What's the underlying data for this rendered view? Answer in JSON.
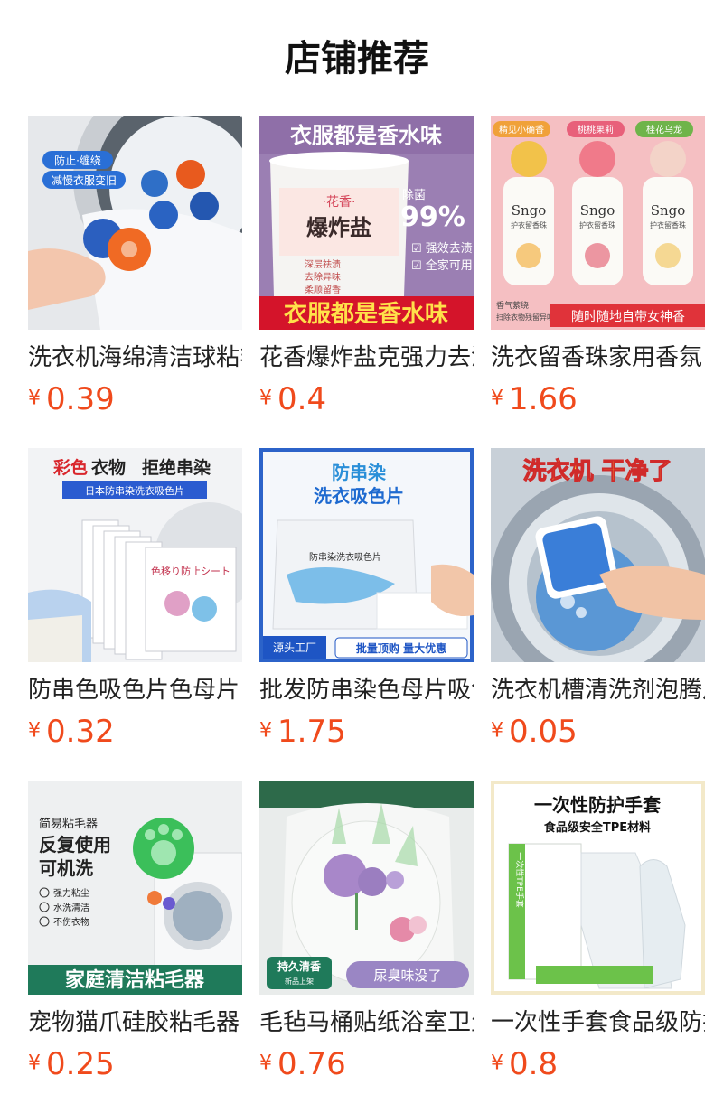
{
  "section": {
    "title": "店铺推荐"
  },
  "products": [
    {
      "name": "洗衣机海绵清洁球粘毛",
      "currency": "¥",
      "price": "0.39",
      "image_text": [
        "防止·缠绕",
        "减慢衣服变旧"
      ]
    },
    {
      "name": "花香爆炸盐克强力去渍",
      "currency": "¥",
      "price": "0.4",
      "image_text": [
        "衣服都是香水味",
        "·花香·",
        "爆炸盐",
        "除菌",
        "99%",
        "☑ 强效去渍",
        "☑ 全家可用",
        "深层祛渍",
        "去除异味",
        "柔顺留香",
        "衣服都是香水味"
      ]
    },
    {
      "name": "洗衣留香珠家用香氛",
      "currency": "¥",
      "price": "1.66",
      "image_text": [
        "精见小确香",
        "桃桃果莉",
        "桂花乌龙",
        "Sngo",
        "Sngo",
        "Sngo",
        "护衣留香珠",
        "护衣留香珠",
        "护衣留香珠",
        "香气萦绕",
        "扫除衣物残留异味",
        "随时随地自带女神香"
      ]
    },
    {
      "name": "防串色吸色片色母片",
      "currency": "¥",
      "price": "0.32",
      "image_text": [
        "彩色",
        "衣物",
        "拒绝串染",
        "日本防串染洗衣吸色片",
        "色移り防止シート"
      ]
    },
    {
      "name": "批发防串染色母片吸色",
      "currency": "¥",
      "price": "1.75",
      "image_text": [
        "防串染",
        "洗衣吸色片",
        "防串染洗衣吸色片",
        "源头工厂",
        "批量顶购 量大优惠"
      ]
    },
    {
      "name": "洗衣机槽清洗剂泡腾片",
      "currency": "¥",
      "price": "0.05",
      "image_text": [
        "洗衣机 干净了"
      ]
    },
    {
      "name": "宠物猫爪硅胶粘毛器",
      "currency": "¥",
      "price": "0.25",
      "image_text": [
        "简易粘毛器",
        "反复使用",
        "可机洗",
        "强力粘尘",
        "水洗清洁",
        "不伤衣物",
        "家庭清洁粘毛器"
      ]
    },
    {
      "name": "毛毡马桶贴纸浴室卫生",
      "currency": "¥",
      "price": "0.76",
      "image_text": [
        "持久清香",
        "新品上架",
        "尿臭味没了"
      ]
    },
    {
      "name": "一次性手套食品级防护",
      "currency": "¥",
      "price": "0.8",
      "image_text": [
        "一次性防护手套",
        "食品级安全TPE材料",
        "一次性TPE手套"
      ]
    }
  ],
  "colors": {
    "price": "#f04a1c",
    "title": "#111111"
  }
}
